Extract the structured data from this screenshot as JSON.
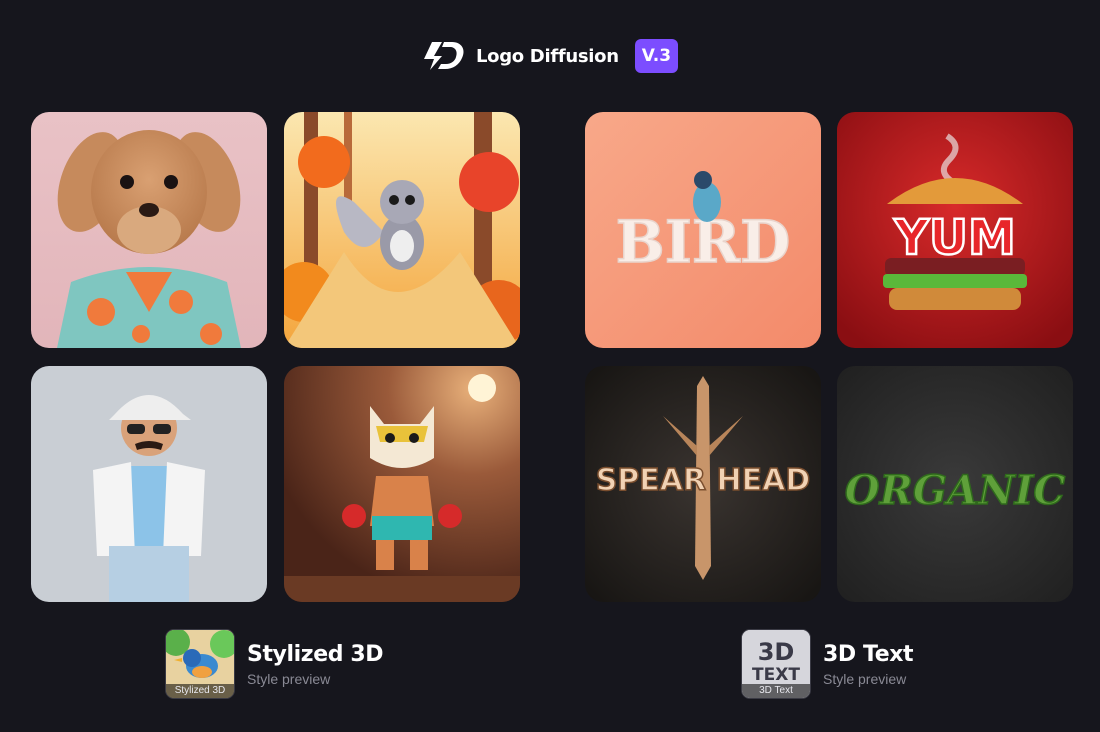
{
  "header": {
    "logo_icon": "logo-diffusion-icon",
    "brand": "Logo Diffusion",
    "version": "V.3"
  },
  "left_group": {
    "tiles": [
      {
        "name": "plush-dog-image",
        "subject": "plush dog in floral shirt"
      },
      {
        "name": "squirrel-image",
        "subject": "cartoon squirrel in autumn forest"
      },
      {
        "name": "man-figurine-image",
        "subject": "3d man with white cap and sunglasses"
      },
      {
        "name": "wrestler-cat-image",
        "subject": "masked wrestler cat"
      }
    ],
    "caption": {
      "title": "Stylized 3D",
      "subtitle": "Style preview",
      "thumb_label": "Stylized 3D"
    }
  },
  "right_group": {
    "tiles": [
      {
        "name": "bird-text-image",
        "text": "BIRD"
      },
      {
        "name": "yum-burger-image",
        "text": "YUM"
      },
      {
        "name": "spear-head-text-image",
        "text": "SPEAR HEAD"
      },
      {
        "name": "organic-text-image",
        "text": "ORGANIC"
      }
    ],
    "caption": {
      "title": "3D Text",
      "subtitle": "Style preview",
      "thumb_big_1": "3D",
      "thumb_big_2": "TEXT",
      "thumb_label": "3D Text"
    }
  },
  "colors": {
    "background": "#16161d",
    "accent": "#7c4dff"
  }
}
